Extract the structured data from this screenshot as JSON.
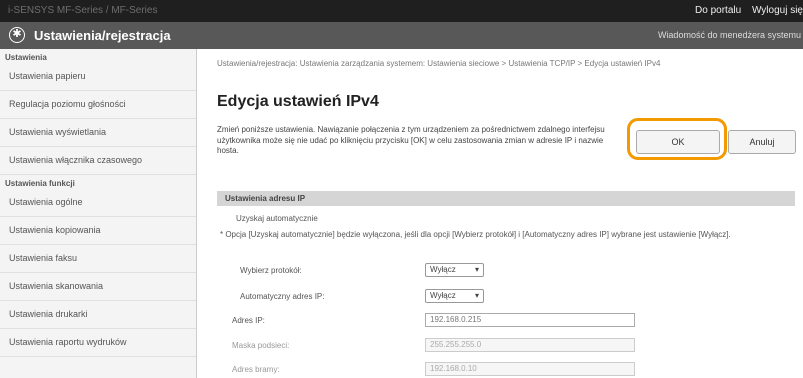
{
  "topbar": {
    "model": "i-SENSYS  MF-Series / MF-Series",
    "portal_link": "Do portalu",
    "logout_link": "Wyloguj się"
  },
  "header": {
    "title": "Ustawienia/rejestracja",
    "admin_message": "Wiadomość do menedżera systemu"
  },
  "sidebar": {
    "group1_title": "Ustawienia",
    "group1_items": [
      "Ustawienia papieru",
      "Regulacja poziomu głośności",
      "Ustawienia wyświetlania",
      "Ustawienia włącznika czasowego"
    ],
    "group2_title": "Ustawienia funkcji",
    "group2_items": [
      "Ustawienia ogólne",
      "Ustawienia kopiowania",
      "Ustawienia faksu",
      "Ustawienia skanowania",
      "Ustawienia drukarki",
      "Ustawienia raportu wydruków"
    ]
  },
  "main": {
    "breadcrumb": "Ustawienia/rejestracja: Ustawienia zarządzania systemem: Ustawienia sieciowe > Ustawienia TCP/IP > Edycja ustawień IPv4",
    "title": "Edycja ustawień IPv4",
    "description": "Zmień poniższe ustawienia. Nawiązanie połączenia z tym urządzeniem za pośrednictwem zdalnego interfejsu użytkownika może się nie udać po kliknięciu przycisku [OK] w celu zastosowania zmian w adresie IP i nazwie hosta.",
    "ok_label": "OK",
    "cancel_label": "Anuluj",
    "section_title": "Ustawienia adresu IP",
    "auto_label": "Uzyskaj automatycznie",
    "note": "* Opcja [Uzyskaj automatycznie] będzie wyłączona, jeśli dla opcji [Wybierz protokół] i [Automatyczny adres IP] wybrane jest ustawienie [Wyłącz].",
    "protocol_label": "Wybierz protokół:",
    "protocol_value": "Wyłącz",
    "autoip_label": "Automatyczny adres IP:",
    "autoip_value": "Wyłącz",
    "ip_label": "Adres IP:",
    "ip_value": "192.168.0.215",
    "mask_label": "Maska podsieci:",
    "mask_value": "255.255.255.0",
    "gateway_label": "Adres bramy:",
    "gateway_value": "192.168.0.10"
  },
  "colors": {
    "highlight": "#f29a00",
    "titlebar": "#585858",
    "topbar": "#1f1f1f"
  },
  "icons": {
    "header_icon": "gear-icon",
    "select_icon": "chevron-down-icon"
  }
}
